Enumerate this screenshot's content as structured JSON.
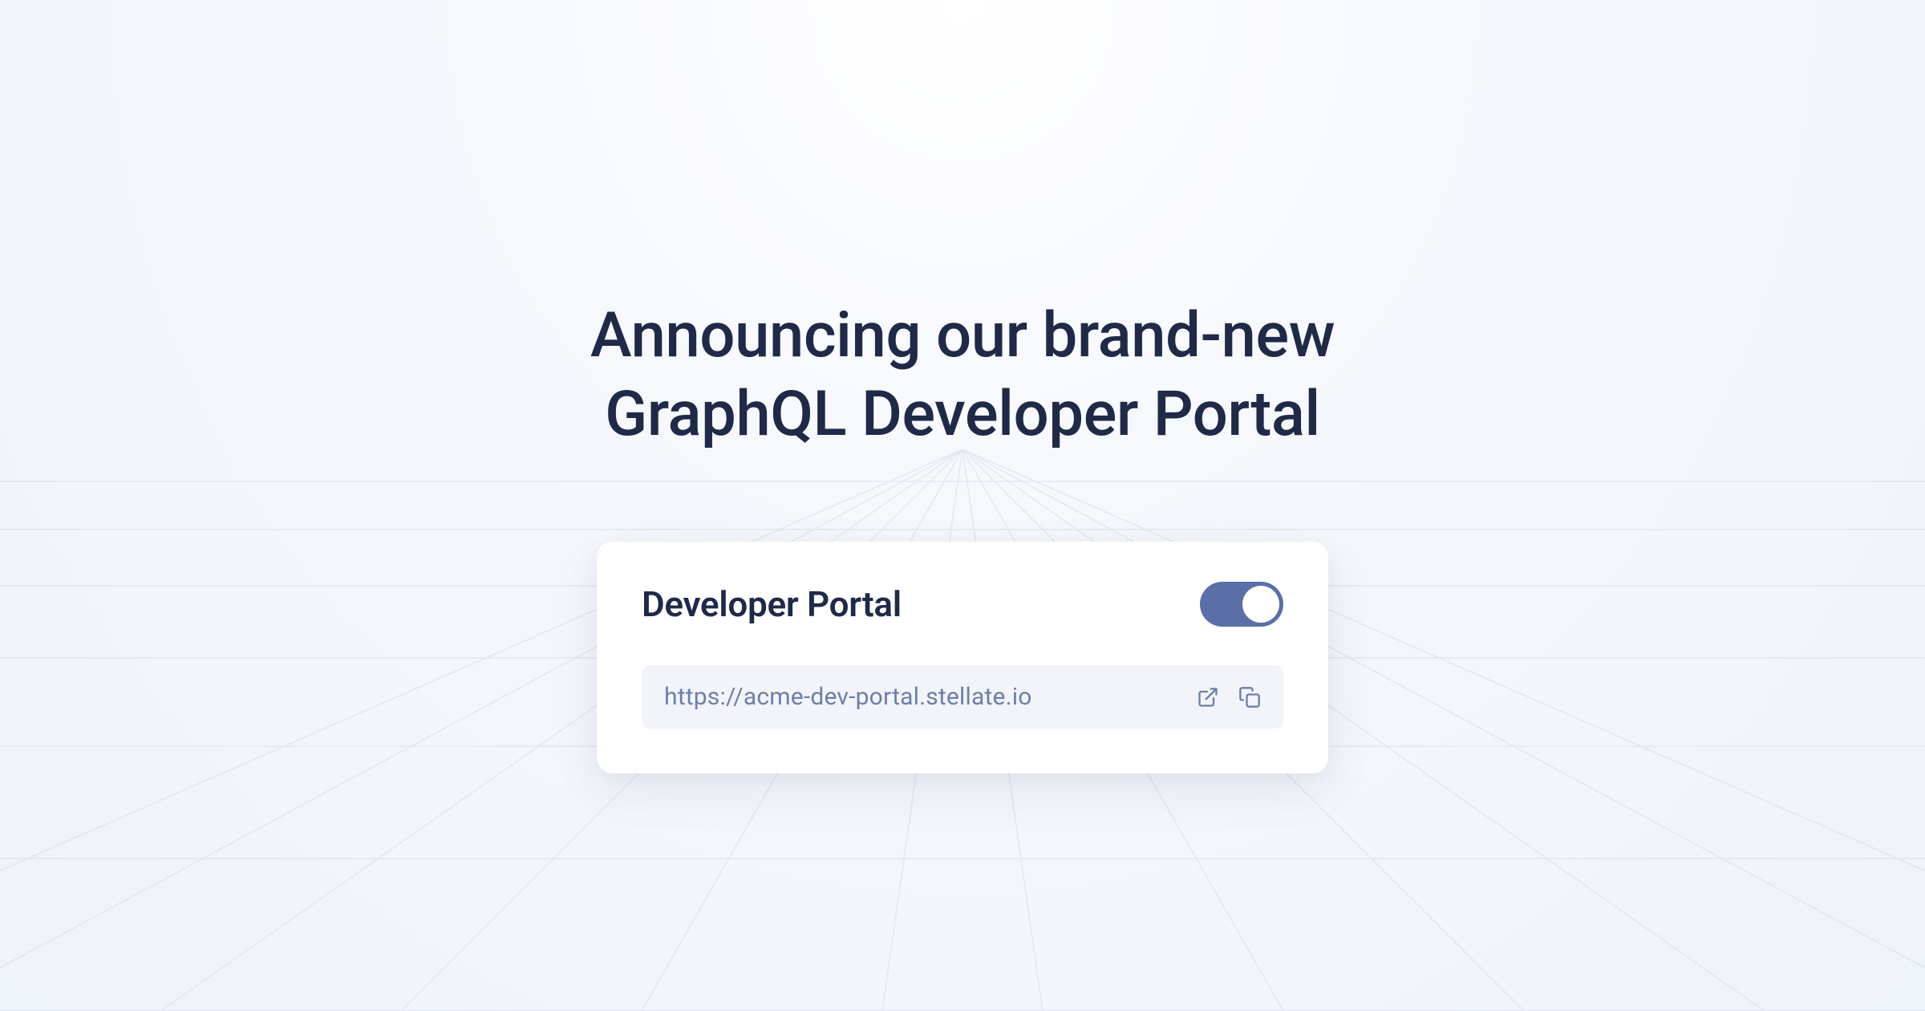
{
  "headline": "Announcing our brand-new\nGraphQL Developer Portal",
  "card": {
    "title": "Developer Portal",
    "toggle_on": true,
    "url": "https://acme-dev-portal.stellate.io"
  },
  "colors": {
    "text_dark": "#1e2a47",
    "accent": "#5a6fa8",
    "muted": "#6b7fa8",
    "card_bg": "#ffffff",
    "url_bg": "#f2f4f9"
  }
}
